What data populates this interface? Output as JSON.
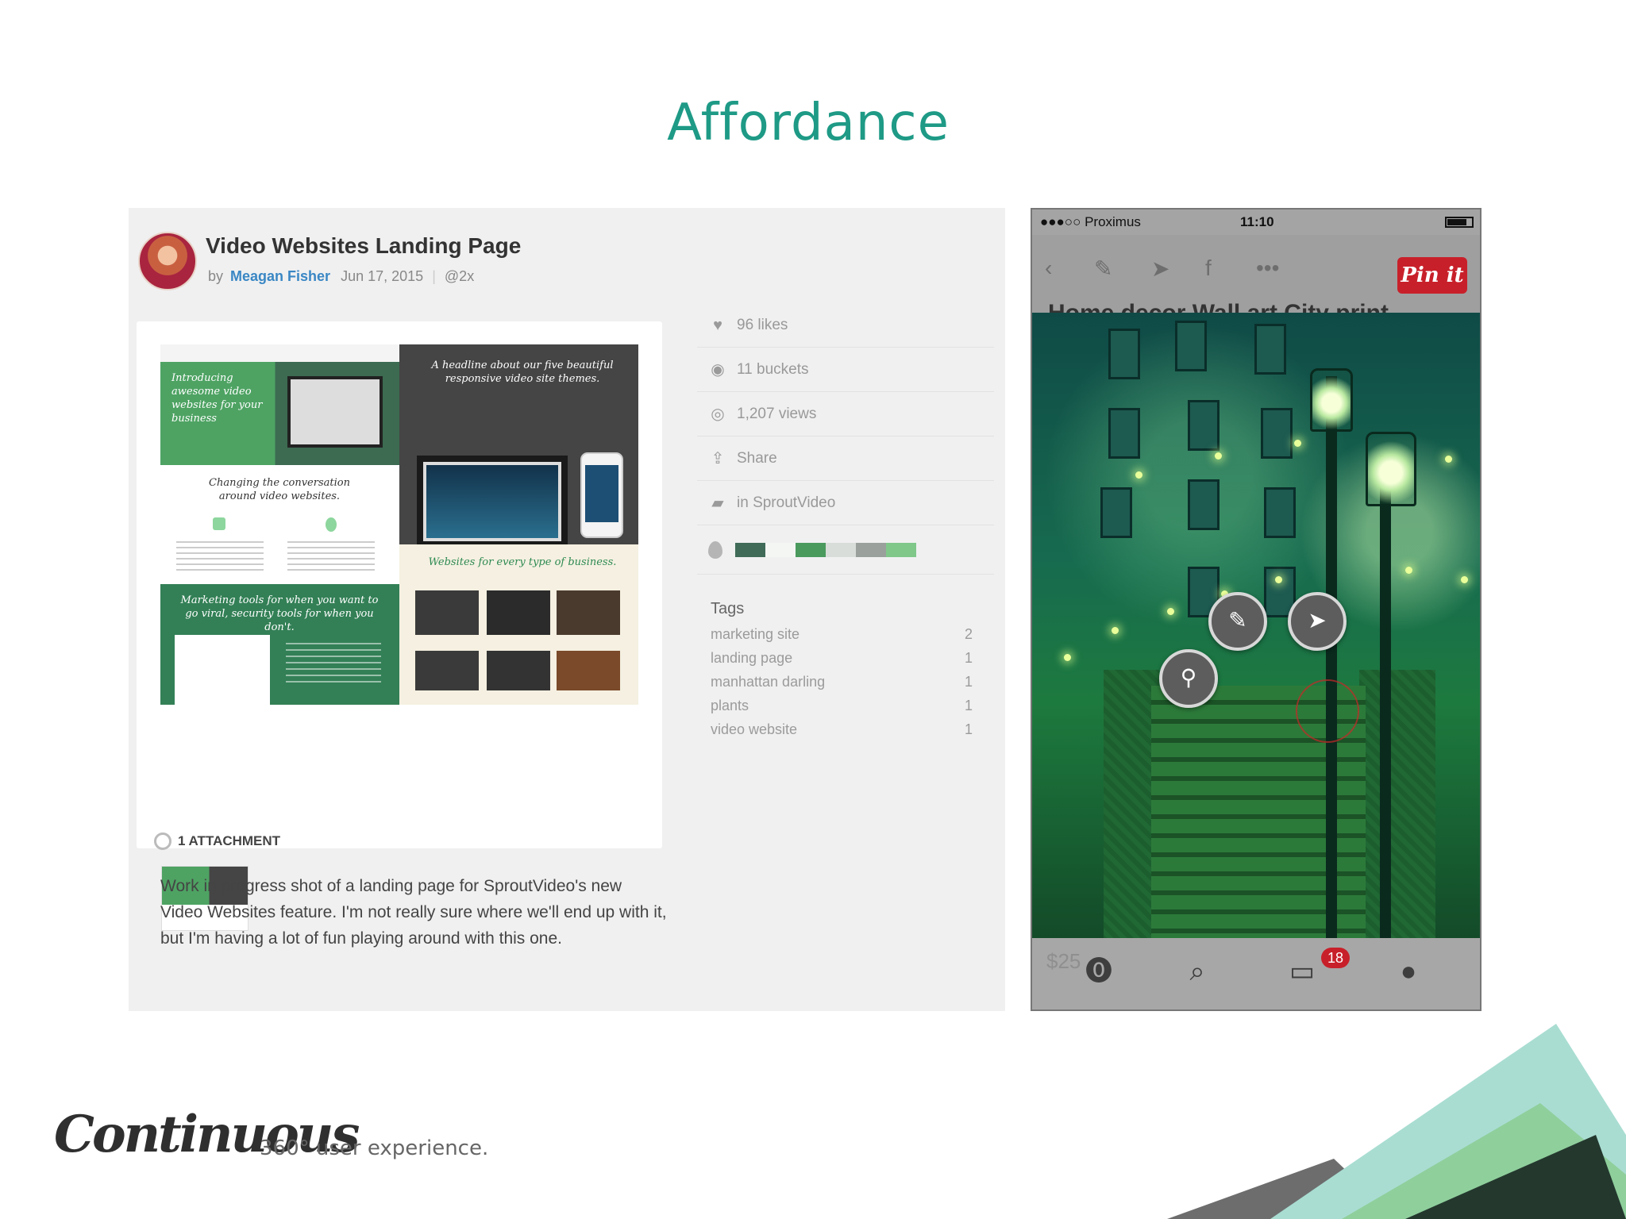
{
  "slide": {
    "title": "Affordance"
  },
  "dribbble": {
    "title": "Video Websites Landing Page",
    "by": "by",
    "author": "Meagan Fisher",
    "date": "Jun 17, 2015",
    "resolution": "@2x",
    "mockup": {
      "hero_script": "Introducing awesome video websites for your business",
      "headline_script": "A headline about our five beautiful responsive video site themes.",
      "changing_script": "Changing the conversation around video websites.",
      "websites_script": "Websites for every type of business.",
      "marketing_script": "Marketing tools for when you want to go viral, security tools for when you don't."
    },
    "attachment_label": "1 ATTACHMENT",
    "stats": [
      {
        "icon": "heart-icon",
        "label": "96 likes"
      },
      {
        "icon": "bucket-icon",
        "label": "11 buckets"
      },
      {
        "icon": "eye-icon",
        "label": "1,207 views"
      },
      {
        "icon": "share-icon",
        "label": "Share"
      },
      {
        "icon": "folder-icon",
        "label": "in SproutVideo"
      }
    ],
    "palette": [
      "#3f6b58",
      "#f4f6f4",
      "#4a9a5e",
      "#d9ddd9",
      "#9aa09c",
      "#7fc88a"
    ],
    "tags_title": "Tags",
    "tags": [
      {
        "name": "marketing site",
        "count": "2"
      },
      {
        "name": "landing page",
        "count": "1"
      },
      {
        "name": "manhattan darling",
        "count": "1"
      },
      {
        "name": "plants",
        "count": "1"
      },
      {
        "name": "video website",
        "count": "1"
      }
    ],
    "description": "Work in progress shot of a landing page for SproutVideo's new Video Websites feature. I'm not really sure where we'll end up with it, but I'm having a lot of fun playing around with this one."
  },
  "pinterest": {
    "carrier": "●●●○○ Proximus",
    "time": "11:10",
    "pin_it": "Pin it",
    "pin_title_cut": "Home decor Wall art City print...",
    "price_ghost": "$25",
    "notification_count": "18"
  },
  "footer": {
    "brand": "Continuous",
    "tagline": "360° user experience."
  },
  "colors": {
    "accent": "#1e9a86",
    "pinterest_red": "#c8202a",
    "author_link": "#3a87c4"
  }
}
